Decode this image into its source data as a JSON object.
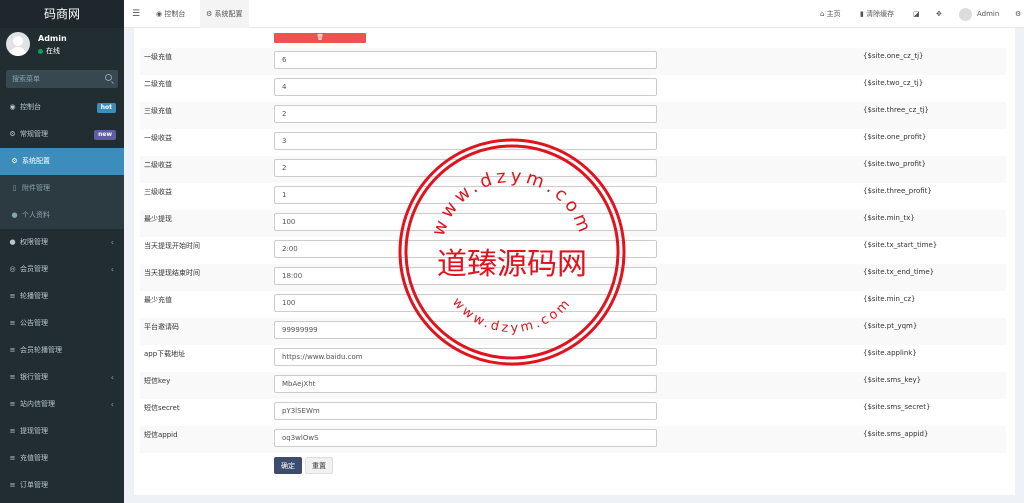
{
  "brand": "码商网",
  "user": {
    "name": "Admin",
    "status": "在线"
  },
  "search": {
    "placeholder": "搜索菜单"
  },
  "sidebar": {
    "items": [
      {
        "icon": "dashboard-icon",
        "glyph": "◉",
        "label": "控制台",
        "badge": "hot"
      },
      {
        "icon": "cogs-icon",
        "glyph": "⚙",
        "label": "常规管理",
        "badge": "new"
      },
      {
        "icon": "cog-icon",
        "glyph": "⚙",
        "label": "系统配置",
        "sub": true,
        "active": true
      },
      {
        "icon": "file-icon",
        "glyph": "▯",
        "label": "附件管理",
        "sub": true
      },
      {
        "icon": "user-icon",
        "glyph": "●",
        "label": "个人资料",
        "sub": true
      },
      {
        "icon": "group-icon",
        "glyph": "●",
        "label": "权限管理",
        "chevron": true
      },
      {
        "icon": "user-circle-icon",
        "glyph": "◎",
        "label": "会员管理",
        "chevron": true
      },
      {
        "icon": "list-icon",
        "glyph": "≡",
        "label": "轮播管理"
      },
      {
        "icon": "list-icon",
        "glyph": "≡",
        "label": "公告管理"
      },
      {
        "icon": "list-icon",
        "glyph": "≡",
        "label": "会员轮播管理"
      },
      {
        "icon": "list-icon",
        "glyph": "≡",
        "label": "银行管理",
        "chevron": true
      },
      {
        "icon": "list-icon",
        "glyph": "≡",
        "label": "站内信管理",
        "chevron": true
      },
      {
        "icon": "list-icon",
        "glyph": "≡",
        "label": "提现管理"
      },
      {
        "icon": "list-icon",
        "glyph": "≡",
        "label": "充值管理"
      },
      {
        "icon": "list-icon",
        "glyph": "≡",
        "label": "订单管理"
      }
    ]
  },
  "topbar": {
    "tabs": [
      {
        "icon": "dashboard-icon",
        "label": "控制台"
      },
      {
        "icon": "cog-icon",
        "label": "系统配置"
      }
    ],
    "home": "主页",
    "clear_cache": "清除缓存",
    "admin": "Admin"
  },
  "form": {
    "rows": [
      {
        "label": "一级充值",
        "value": "6",
        "var": "{$site.one_cz_tj}"
      },
      {
        "label": "二级充值",
        "value": "4",
        "var": "{$site.two_cz_tj}"
      },
      {
        "label": "三级充值",
        "value": "2",
        "var": "{$site.three_cz_tj}"
      },
      {
        "label": "一级收益",
        "value": "3",
        "var": "{$site.one_profit}"
      },
      {
        "label": "二级收益",
        "value": "2",
        "var": "{$site.two_profit}"
      },
      {
        "label": "三级收益",
        "value": "1",
        "var": "{$site.three_profit}"
      },
      {
        "label": "最少提现",
        "value": "100",
        "var": "{$site.min_tx}"
      },
      {
        "label": "当天提现开始时间",
        "value": "2:00",
        "var": "{$site.tx_start_time}"
      },
      {
        "label": "当天提现结束时间",
        "value": "18:00",
        "var": "{$site.tx_end_time}"
      },
      {
        "label": "最少充值",
        "value": "100",
        "var": "{$site.min_cz}"
      },
      {
        "label": "平台邀请码",
        "value": "99999999",
        "var": "{$site.pt_yqm}"
      },
      {
        "label": "app下载地址",
        "value": "https://www.baidu.com",
        "var": "{$site.applink}"
      },
      {
        "label": "短信key",
        "value": "MbAejXht",
        "var": "{$site.sms_key}"
      },
      {
        "label": "短信secret",
        "value": "pY3lSEWm",
        "var": "{$site.sms_secret}"
      },
      {
        "label": "短信appid",
        "value": "oq3wlOwS",
        "var": "{$site.sms_appid}"
      }
    ],
    "confirm": "确定",
    "reset": "重置"
  },
  "watermark": {
    "text": "道臻源码网",
    "top_url": "www.dzym.com",
    "bottom_url": "www.dzym.com",
    "color": "#e0141e"
  },
  "colors": {
    "sidebar": "#222d32",
    "active": "#3c8dbc",
    "danger": "#f05050",
    "primary": "#3d4b6e"
  }
}
